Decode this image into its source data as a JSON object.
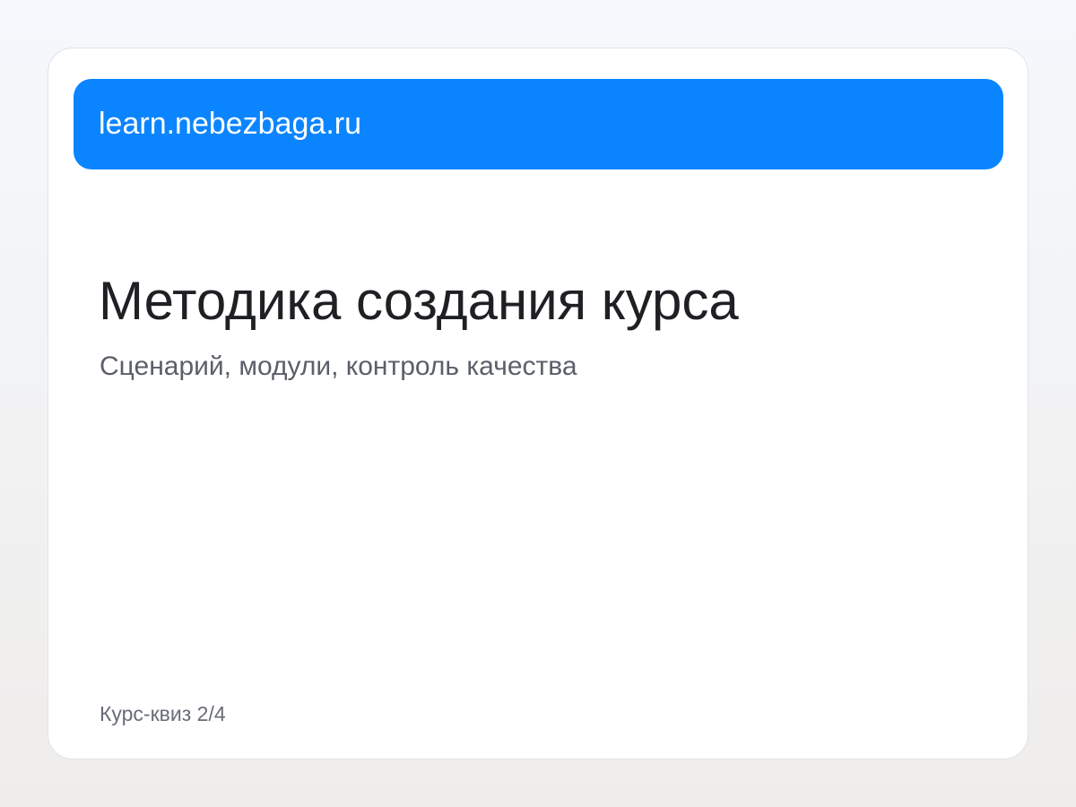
{
  "header": {
    "url": "learn.nebezbaga.ru",
    "accent_color": "#0b85ff"
  },
  "main": {
    "title": "Методика создания курса",
    "subtitle": "Сценарий, модули, контроль качества"
  },
  "footer": {
    "progress_label": "Курс-квиз 2/4"
  }
}
